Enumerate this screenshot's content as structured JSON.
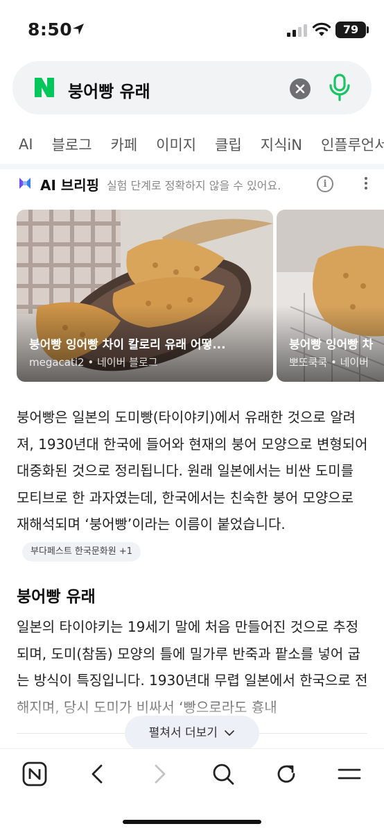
{
  "status_bar": {
    "time": "8:50",
    "battery": "79"
  },
  "search": {
    "query": "붕어빵 유래"
  },
  "tabs": [
    "AI",
    "블로그",
    "카페",
    "이미지",
    "클립",
    "지식iN",
    "인플루언서"
  ],
  "ai_briefing": {
    "title": "AI 브리핑",
    "disclaimer": "실험 단계로 정확하지 않을 수 있어요."
  },
  "cards": [
    {
      "title": "붕어빵 잉어빵 차이 칼로리 유래 어떻...",
      "source": "megacati2 • 네이버 블로그"
    },
    {
      "title": "붕어빵 잉어빵 차",
      "source": "뽀또쿡쿡 • 네이버"
    }
  ],
  "paragraph_1": "붕어빵은 일본의 도미빵(타이야키)에서 유래한 것으로 알려져, 1930년대 한국에 들어와 현재의 붕어 모양으로 변형되어 대중화된 것으로 정리됩니다. 원래 일본에서는 비싼 도미를 모티브로 한 과자였는데, 한국에서는 친숙한 붕어 모양으로 재해석되며 ‘붕어빵’이라는 이름이 붙었습니다.",
  "citation": "부다페스트 한국문화원 +1",
  "section_heading": "붕어빵 유래",
  "paragraph_2": "일본의 타이야키는 19세기 말에 처음 만들어진 것으로 추정되며, 도미(참돔) 모양의 틀에 밀가루 반죽과 팥소를 넣어 굽는 방식이 특징입니다. 1930년대 무렵 일본에서 한국으로 전해지며, 당시 도미가 비싸서 ‘빵으로라도 흉내",
  "expand_button": "펼쳐서 더보기",
  "colors": {
    "naver_green": "#03C75A",
    "mic_green": "#19C463",
    "ai_purple": "#6C4DF6",
    "ai_blue": "#2F80ED"
  },
  "icons": [
    "location-arrow-icon",
    "signal-icon",
    "wifi-icon",
    "battery-icon",
    "naver-logo-icon",
    "clear-icon",
    "mic-icon",
    "ai-logo-icon",
    "info-icon",
    "more-icon",
    "naver-home-icon",
    "back-icon",
    "forward-icon",
    "search-icon",
    "refresh-icon",
    "menu-icon",
    "chevron-down-icon"
  ]
}
